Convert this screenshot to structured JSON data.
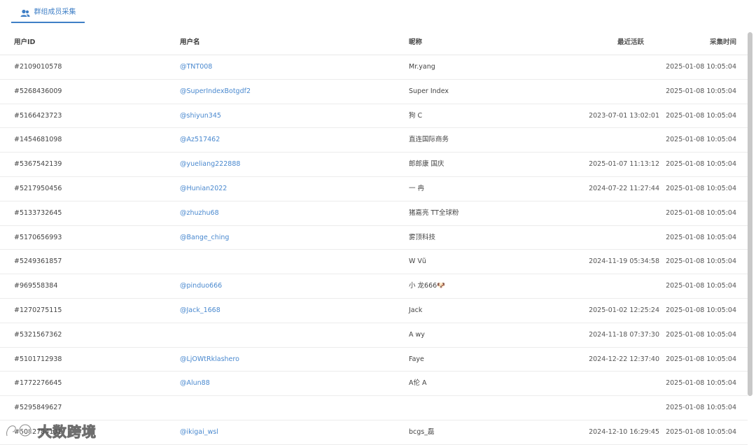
{
  "tab": {
    "label": "群组成员采集"
  },
  "columns": {
    "id": "用户ID",
    "username": "用户名",
    "nickname": "昵称",
    "last_active": "最近活跃",
    "collected": "采集时间"
  },
  "rows": [
    {
      "id": "#2109010578",
      "username": "@TNT008",
      "nickname": "Mr.yang",
      "last_active": "",
      "collected": "2025-01-08 10:05:04"
    },
    {
      "id": "#5268436009",
      "username": "@SuperIndexBotgdf2",
      "nickname": "Super Index",
      "last_active": "",
      "collected": "2025-01-08 10:05:04"
    },
    {
      "id": "#5166423723",
      "username": "@shiyun345",
      "nickname": "狗 C",
      "last_active": "2023-07-01 13:02:01",
      "collected": "2025-01-08 10:05:04"
    },
    {
      "id": "#1454681098",
      "username": "@Az517462",
      "nickname": "直连国际商务",
      "last_active": "",
      "collected": "2025-01-08 10:05:04"
    },
    {
      "id": "#5367542139",
      "username": "@yueliang222888",
      "nickname": "郎郎康 国庆",
      "last_active": "2025-01-07 11:13:12",
      "collected": "2025-01-08 10:05:04"
    },
    {
      "id": "#5217950456",
      "username": "@Hunian2022",
      "nickname": "一 冉",
      "last_active": "2024-07-22 11:27:44",
      "collected": "2025-01-08 10:05:04"
    },
    {
      "id": "#5133732645",
      "username": "@zhuzhu68",
      "nickname": "猪嘉亮 TT全球粉",
      "last_active": "",
      "collected": "2025-01-08 10:05:04"
    },
    {
      "id": "#5170656993",
      "username": "@Bange_ching",
      "nickname": "雾顶科技",
      "last_active": "",
      "collected": "2025-01-08 10:05:04"
    },
    {
      "id": "#5249361857",
      "username": "",
      "nickname": "W Vũ",
      "last_active": "2024-11-19 05:34:58",
      "collected": "2025-01-08 10:05:04"
    },
    {
      "id": "#969558384",
      "username": "@pinduo666",
      "nickname": "小 龙666🐶",
      "last_active": "",
      "collected": "2025-01-08 10:05:04"
    },
    {
      "id": "#1270275115",
      "username": "@Jack_1668",
      "nickname": "Jack",
      "last_active": "2025-01-02 12:25:24",
      "collected": "2025-01-08 10:05:04"
    },
    {
      "id": "#5321567362",
      "username": "",
      "nickname": "A wy",
      "last_active": "2024-11-18 07:37:30",
      "collected": "2025-01-08 10:05:04"
    },
    {
      "id": "#5101712938",
      "username": "@LjOWtRklashero",
      "nickname": "Faye",
      "last_active": "2024-12-22 12:37:40",
      "collected": "2025-01-08 10:05:04"
    },
    {
      "id": "#1772276645",
      "username": "@Alun88",
      "nickname": "A伦 A",
      "last_active": "",
      "collected": "2025-01-08 10:05:04"
    },
    {
      "id": "#5295849627",
      "username": "",
      "nickname": "",
      "last_active": "",
      "collected": "2025-01-08 10:05:04"
    },
    {
      "id": "#5082784131",
      "username": "@ikigai_wsl",
      "nickname": "bcgs_磊",
      "last_active": "2024-12-10 16:29:45",
      "collected": "2025-01-08 10:05:04"
    }
  ],
  "watermark": {
    "text": "大数跨境"
  },
  "colors": {
    "accent": "#3f7fc6",
    "link": "#4a89cf",
    "divider": "#ececec"
  },
  "icons": {
    "tab": "users-icon",
    "watermark": "brand-logo-icon"
  }
}
